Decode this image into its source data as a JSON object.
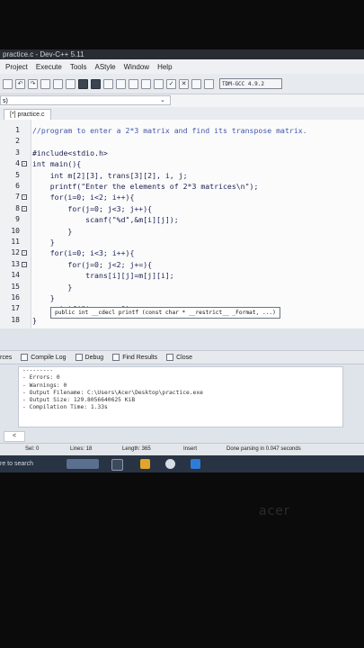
{
  "window": {
    "title": "practice.c - Dev-C++ 5.11"
  },
  "menu": [
    "Project",
    "Execute",
    "Tools",
    "AStyle",
    "Window",
    "Help"
  ],
  "toolbar": {
    "compiler": "TDM-GCC 4.9.2"
  },
  "scope": {
    "value": "s)"
  },
  "editor": {
    "tab": "[*] practice.c",
    "lines": [
      {
        "n": "1",
        "text": "//program to enter a 2*3 matrix and find its transpose matrix.",
        "fold": "",
        "comment": true
      },
      {
        "n": "2",
        "text": "",
        "fold": ""
      },
      {
        "n": "3",
        "text": "#include<stdio.h>",
        "fold": ""
      },
      {
        "n": "4",
        "text": "int main(){",
        "fold": "-"
      },
      {
        "n": "5",
        "text": "    int m[2][3], trans[3][2], i, j;",
        "fold": ""
      },
      {
        "n": "6",
        "text": "    printf(\"Enter the elements of 2*3 matrices\\n\");",
        "fold": ""
      },
      {
        "n": "7",
        "text": "    for(i=0; i<2; i++){",
        "fold": "-"
      },
      {
        "n": "8",
        "text": "        for(j=0; j<3; j++){",
        "fold": "-"
      },
      {
        "n": "9",
        "text": "            scanf(\"%d\",&m[i][j]);",
        "fold": ""
      },
      {
        "n": "10",
        "text": "        }",
        "fold": ""
      },
      {
        "n": "11",
        "text": "    }",
        "fold": ""
      },
      {
        "n": "12",
        "text": "    for(i=0; i<3; i++){",
        "fold": "-"
      },
      {
        "n": "13",
        "text": "        for(j=0; j<2; j+=){",
        "fold": "-"
      },
      {
        "n": "14",
        "text": "            trans[i][j]=m[j][i];",
        "fold": ""
      },
      {
        "n": "15",
        "text": "        }",
        "fold": ""
      },
      {
        "n": "16",
        "text": "    }",
        "fold": ""
      },
      {
        "n": "17",
        "text": "    printf(\"transpos\")",
        "fold": ""
      },
      {
        "n": "18",
        "text": "}",
        "fold": ""
      }
    ],
    "tooltip": "public int __cdecl printf (const char * __restrict__ _Format, ...)"
  },
  "bottom_tabs": [
    "rces",
    "Compile Log",
    "Debug",
    "Find Results",
    "Close"
  ],
  "log": [
    "---------",
    "- Errors: 0",
    "- Warnings: 0",
    "- Output Filename: C:\\Users\\Acer\\Desktop\\practice.exe",
    "- Output Size: 129.8056640625 KiB",
    "- Compilation Time: 1.33s"
  ],
  "log_nav": "<",
  "status": {
    "sel": "Sel:  0",
    "lines": "Lines:  18",
    "length": "Length:  365",
    "insert": "Insert",
    "parse": "Done parsing in 0.047 seconds"
  },
  "taskbar": {
    "search": "re to search"
  },
  "bezel": {
    "logo": "acer"
  }
}
